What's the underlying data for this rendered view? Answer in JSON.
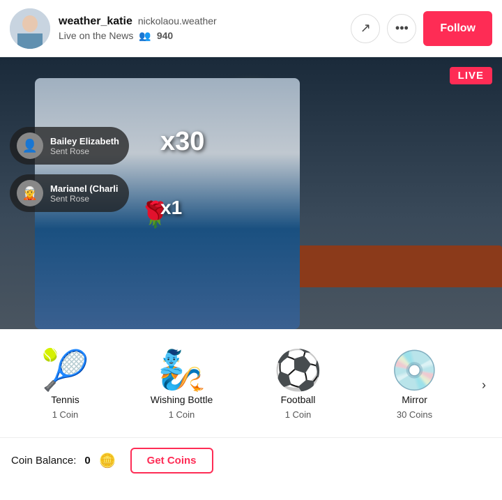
{
  "header": {
    "username": "weather_katie",
    "display_name": "nickolaou.weather",
    "live_label": "Live on the News",
    "viewers_icon": "👥",
    "viewer_count": "940",
    "share_icon": "↗",
    "more_icon": "•••",
    "follow_label": "Follow"
  },
  "video": {
    "live_badge": "LIVE",
    "multiplier1": "x30",
    "multiplier2": "x1",
    "notifications": [
      {
        "name": "Bailey Elizabeth",
        "action": "Sent Rose",
        "avatar_emoji": "👤"
      },
      {
        "name": "Marianel (Charli",
        "action": "Sent Rose",
        "avatar_emoji": "🧝"
      }
    ],
    "rose_emoji": "🌹"
  },
  "gifts": {
    "arrow_label": "›",
    "items": [
      {
        "name": "Tennis",
        "cost": "1 Coin",
        "emoji": "🎾"
      },
      {
        "name": "Wishing Bottle",
        "cost": "1 Coin",
        "emoji": "🧞"
      },
      {
        "name": "Football",
        "cost": "1 Coin",
        "emoji": "⚽"
      },
      {
        "name": "Mirror",
        "cost": "30 Coins",
        "emoji": "💿"
      }
    ]
  },
  "bottom_bar": {
    "coin_balance_label": "Coin Balance:",
    "coin_balance_value": "0",
    "coin_icon": "🪙",
    "get_coins_label": "Get Coins"
  }
}
